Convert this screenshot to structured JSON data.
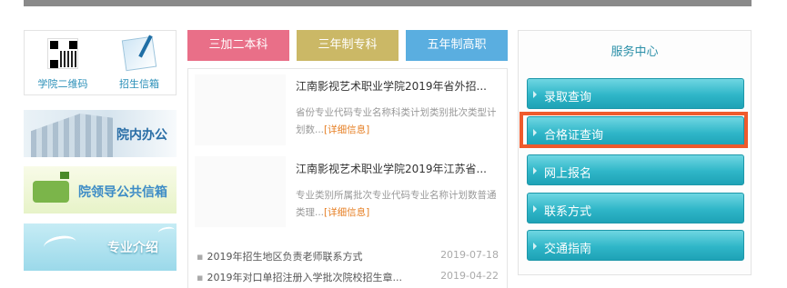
{
  "quick_links": [
    {
      "label": "学院二维码",
      "icon": "qr-code-icon"
    },
    {
      "label": "招生信箱",
      "icon": "mail-icon"
    }
  ],
  "promos": [
    {
      "label": "院内办公"
    },
    {
      "label": "院领导公共信箱"
    },
    {
      "label": "专业介绍"
    }
  ],
  "tabs": [
    {
      "label": "三加二本科",
      "color": "#e96f88"
    },
    {
      "label": "三年制专科",
      "color": "#cbb866"
    },
    {
      "label": "五年制高职",
      "color": "#5aaee0"
    }
  ],
  "articles": [
    {
      "title": "江南影视艺术职业学院2019年省外招...",
      "summary": "省份专业代码专业名称科类计划类别批次类型计划数...",
      "more": "[详细信息]"
    },
    {
      "title": "江南影视艺术职业学院2019年江苏省...",
      "summary": "专业类别所属批次专业代码专业名称计划数普通类理...",
      "more": "[详细信息]"
    }
  ],
  "news_list": [
    {
      "title": "2019年招生地区负责老师联系方式",
      "date": "2019-07-18"
    },
    {
      "title": "2019年对口单招注册入学批次院校招生章...",
      "date": "2019-04-22"
    }
  ],
  "service": {
    "title": "服务中心",
    "buttons": [
      {
        "label": "录取查询"
      },
      {
        "label": "合格证查询"
      },
      {
        "label": "网上报名"
      },
      {
        "label": "联系方式"
      },
      {
        "label": "交通指南"
      }
    ],
    "highlight_color": "#ef5a2c"
  }
}
